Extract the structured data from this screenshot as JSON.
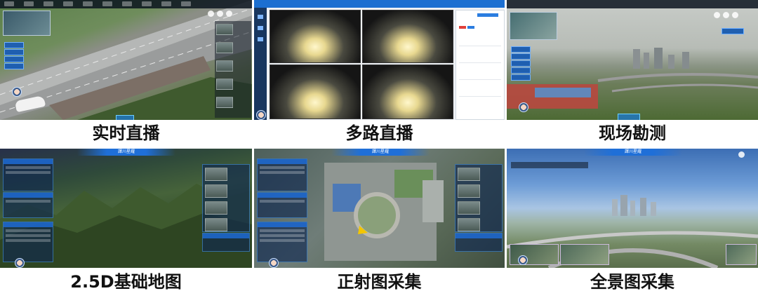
{
  "panels": [
    {
      "id": "live",
      "caption": "实时直播"
    },
    {
      "id": "multi",
      "caption": "多路直播"
    },
    {
      "id": "survey",
      "caption": "现场勘测"
    },
    {
      "id": "map25d",
      "caption": "2.5D基础地图"
    },
    {
      "id": "ortho",
      "caption": "正射图采集"
    },
    {
      "id": "pano",
      "caption": "全景图采集"
    }
  ],
  "header_title": "譯川星耀",
  "colors": {
    "brand_blue": "#1f6fd8",
    "panel_dark": "#0a141e",
    "accent": "#6fd0ff"
  },
  "icons": [
    "avatar-icon",
    "camera-icon",
    "layers-icon",
    "settings-icon"
  ]
}
